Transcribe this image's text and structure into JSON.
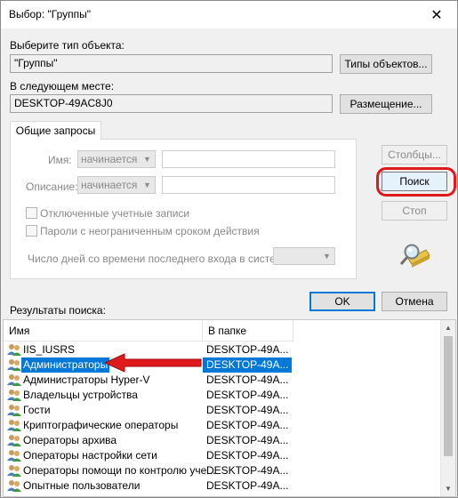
{
  "window": {
    "title": "Выбор: \"Группы\"",
    "close_glyph": "✕"
  },
  "object_type": {
    "label": "Выберите тип объекта:",
    "value": "\"Группы\"",
    "button": "Типы объектов..."
  },
  "location": {
    "label": "В следующем месте:",
    "value": "DESKTOP-49AC8J0",
    "button": "Размещение..."
  },
  "common_queries": {
    "tab": "Общие запросы",
    "name_label": "Имя:",
    "name_combo": "начинается с",
    "description_label": "Описание:",
    "description_combo": "начинается с",
    "disabled_accounts": "Отключенные учетные записи",
    "no_expire_passwords": "Пароли с неограниченным сроком действия",
    "days_since_logon": "Число дней со времени последнего входа в систему:"
  },
  "buttons": {
    "columns": "Столбцы...",
    "search": "Поиск",
    "stop": "Стоп",
    "ok": "OK",
    "cancel": "Отмена"
  },
  "results": {
    "label": "Результаты поиска:",
    "headers": {
      "name": "Имя",
      "folder": "В папке"
    },
    "rows": [
      {
        "name": "IIS_IUSRS",
        "folder": "DESKTOP-49A..."
      },
      {
        "name": "Администраторы",
        "folder": "DESKTOP-49A..."
      },
      {
        "name": "Администраторы Hyper-V",
        "folder": "DESKTOP-49A..."
      },
      {
        "name": "Владельцы устройства",
        "folder": "DESKTOP-49A..."
      },
      {
        "name": "Гости",
        "folder": "DESKTOP-49A..."
      },
      {
        "name": "Криптографические операторы",
        "folder": "DESKTOP-49A..."
      },
      {
        "name": "Операторы архива",
        "folder": "DESKTOP-49A..."
      },
      {
        "name": "Операторы настройки сети",
        "folder": "DESKTOP-49A..."
      },
      {
        "name": "Операторы помощи по контролю уче...",
        "folder": "DESKTOP-49A..."
      },
      {
        "name": "Опытные пользователи",
        "folder": "DESKTOP-49A..."
      }
    ],
    "selected_index": 1
  },
  "colors": {
    "selection": "#0078d7",
    "annotation": "#e0191c"
  }
}
